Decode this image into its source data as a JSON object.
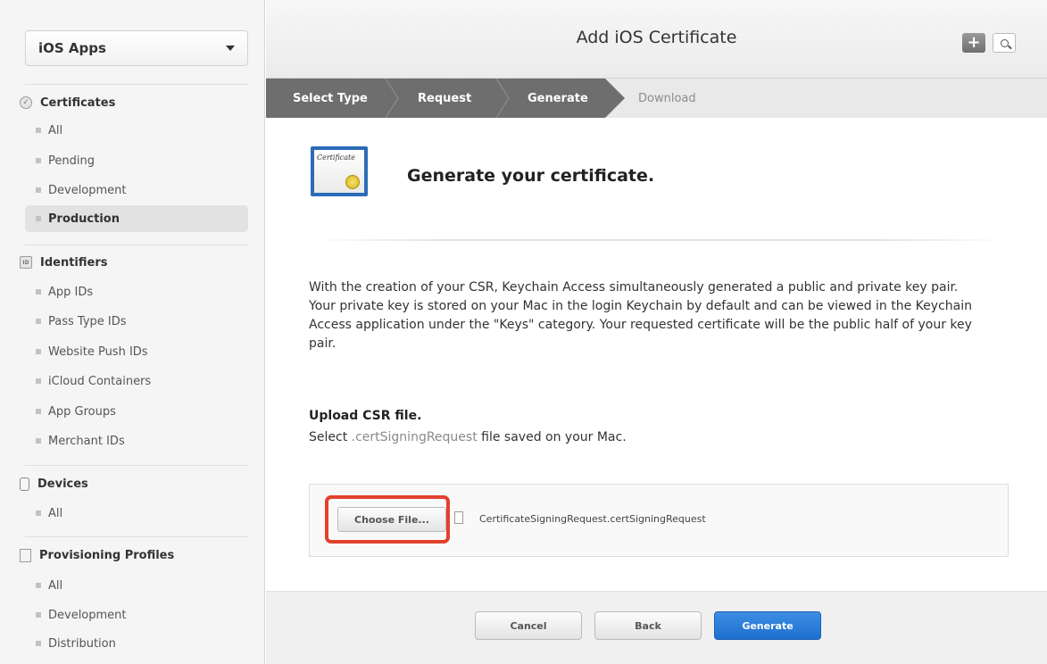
{
  "sidebar": {
    "dropdown_label": "iOS Apps",
    "sections": [
      {
        "label": "Certificates",
        "icon": "certificate-icon",
        "items": [
          "All",
          "Pending",
          "Development",
          "Production"
        ],
        "active": "Production"
      },
      {
        "label": "Identifiers",
        "icon": "id-icon",
        "icon_text": "ID",
        "items": [
          "App IDs",
          "Pass Type IDs",
          "Website Push IDs",
          "iCloud Containers",
          "App Groups",
          "Merchant IDs"
        ]
      },
      {
        "label": "Devices",
        "icon": "device-icon",
        "items": [
          "All"
        ]
      },
      {
        "label": "Provisioning Profiles",
        "icon": "profile-icon",
        "items": [
          "All",
          "Development",
          "Distribution"
        ]
      }
    ]
  },
  "header": {
    "title": "Add iOS Certificate",
    "plus_label": "+"
  },
  "steps": [
    {
      "label": "Select Type",
      "state": "done"
    },
    {
      "label": "Request",
      "state": "done"
    },
    {
      "label": "Generate",
      "state": "current"
    },
    {
      "label": "Download",
      "state": "pending"
    }
  ],
  "content": {
    "certificate_icon_text": "Certificate",
    "heading": "Generate your certificate.",
    "description": "With the creation of your CSR, Keychain Access simultaneously generated a public and private key pair. Your private key is stored on your Mac in the login Keychain by default and can be viewed in the Keychain Access application under the \"Keys\" category. Your requested certificate will be the public half of your key pair.",
    "upload_title": "Upload CSR file.",
    "upload_sub_before": "Select ",
    "upload_sub_ext": ".certSigningRequest",
    "upload_sub_after": " file saved on your Mac.",
    "choose_file_label": "Choose File...",
    "file_name": "CertificateSigningRequest.certSigningRequest"
  },
  "footer": {
    "cancel_label": "Cancel",
    "back_label": "Back",
    "generate_label": "Generate"
  },
  "colors": {
    "accent_blue": "#2a7ad8",
    "step_active": "#6e6e6e",
    "highlight_red": "#e2412e"
  }
}
